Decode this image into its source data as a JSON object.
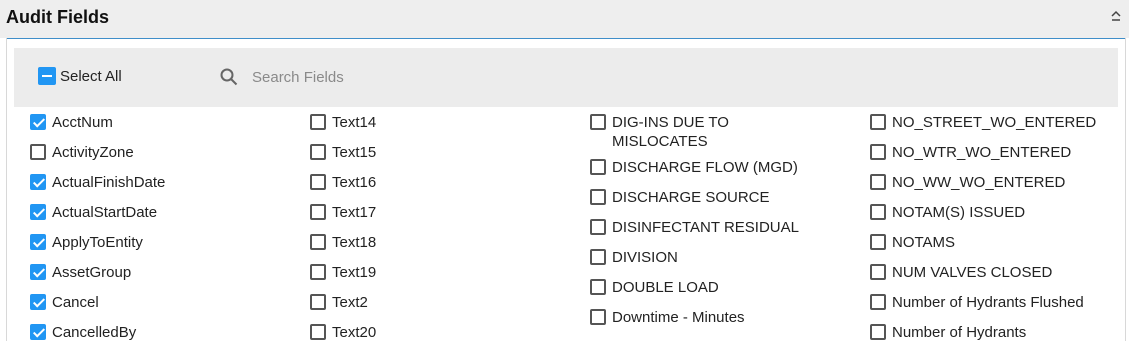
{
  "panel": {
    "title": "Audit Fields"
  },
  "toolbar": {
    "select_all_label": "Select All",
    "search_placeholder": "Search Fields"
  },
  "colors": {
    "accent": "#2196f3",
    "header_rule": "#3f8ec9"
  },
  "fields": {
    "col1": [
      {
        "label": "AcctNum",
        "checked": true
      },
      {
        "label": "ActivityZone",
        "checked": false
      },
      {
        "label": "ActualFinishDate",
        "checked": true
      },
      {
        "label": "ActualStartDate",
        "checked": true
      },
      {
        "label": "ApplyToEntity",
        "checked": true
      },
      {
        "label": "AssetGroup",
        "checked": true
      },
      {
        "label": "Cancel",
        "checked": true
      },
      {
        "label": "CancelledBy",
        "checked": true
      }
    ],
    "col2": [
      {
        "label": "Text14",
        "checked": false
      },
      {
        "label": "Text15",
        "checked": false
      },
      {
        "label": "Text16",
        "checked": false
      },
      {
        "label": "Text17",
        "checked": false
      },
      {
        "label": "Text18",
        "checked": false
      },
      {
        "label": "Text19",
        "checked": false
      },
      {
        "label": "Text2",
        "checked": false
      },
      {
        "label": "Text20",
        "checked": false
      }
    ],
    "col3": [
      {
        "label": "DIG-INS DUE TO",
        "label2": "MISLOCATES",
        "checked": false
      },
      {
        "label": "DISCHARGE FLOW (MGD)",
        "checked": false
      },
      {
        "label": "DISCHARGE SOURCE",
        "checked": false
      },
      {
        "label": "DISINFECTANT RESIDUAL",
        "checked": false
      },
      {
        "label": "DIVISION",
        "checked": false
      },
      {
        "label": "DOUBLE LOAD",
        "checked": false
      },
      {
        "label": "Downtime - Minutes",
        "checked": false
      }
    ],
    "col4": [
      {
        "label": "NO_STREET_WO_ENTERED",
        "checked": false
      },
      {
        "label": "NO_WTR_WO_ENTERED",
        "checked": false
      },
      {
        "label": "NO_WW_WO_ENTERED",
        "checked": false
      },
      {
        "label": "NOTAM(S) ISSUED",
        "checked": false
      },
      {
        "label": "NOTAMS",
        "checked": false
      },
      {
        "label": "NUM VALVES CLOSED",
        "checked": false
      },
      {
        "label": "Number of Hydrants Flushed",
        "checked": false
      },
      {
        "label": "Number of Hydrants",
        "checked": false
      }
    ]
  }
}
